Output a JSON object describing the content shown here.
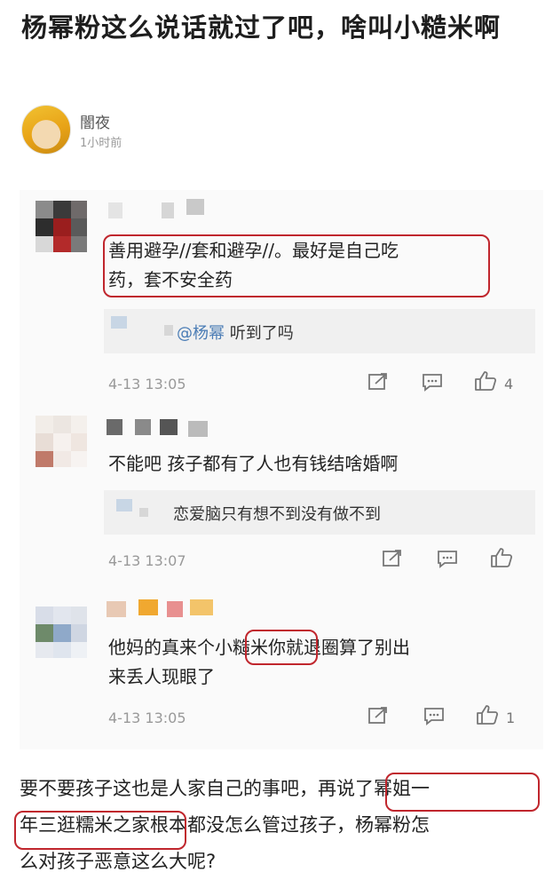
{
  "article": {
    "title": "杨幂粉这么说话就过了吧，啥叫小糙米啊",
    "author": "闇夜",
    "time": "1小时前"
  },
  "comments": [
    {
      "text_line1": "善用避孕//套和避孕//。最好是自己吃",
      "text_line2": "药，套不安全药",
      "reply_mention": "@杨幂",
      "reply_text": " 听到了吗",
      "time": "4-13 13:05",
      "like_count": "4"
    },
    {
      "text_line1": "不能吧 孩子都有了人也有钱结啥婚啊",
      "reply_text": "恋爱脑只有想不到没有做不到",
      "time": "4-13 13:07",
      "like_count": ""
    },
    {
      "text_line1_a": "他妈的真来个",
      "text_line1_b": "小糙米",
      "text_line1_c": "你就退圈算了别出",
      "text_line2": "来丢人现眼了",
      "time": "4-13 13:05",
      "like_count": "1"
    }
  ],
  "bottom": {
    "line1_a": "要不要孩子这也是人家自己的事吧，",
    "line1_b": "再说了幂姐一",
    "line2_a": "年三逛糯米之家",
    "line2_b": "根本都没怎么管过孩子，杨幂粉怎",
    "line3": "么对孩子恶意这么大呢?"
  },
  "colors": {
    "highlight": "#c0262d",
    "mention": "#4a7cb5",
    "comment_bg": "#fafafa",
    "reply_bg": "#f0f0f0"
  },
  "icons": [
    "share-icon",
    "comment-icon",
    "like-icon"
  ]
}
